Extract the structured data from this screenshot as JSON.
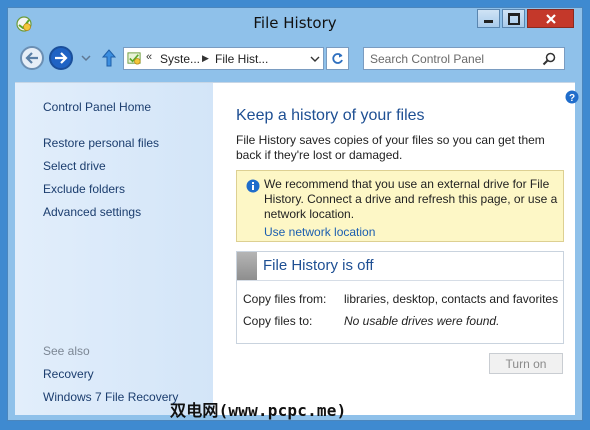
{
  "window": {
    "title": "File History",
    "min_label": "",
    "max_label": ""
  },
  "navbar": {
    "address_chevron": "«",
    "address_segments": [
      "Syste...",
      "File Hist..."
    ],
    "search_placeholder": "Search Control Panel",
    "search_value": ""
  },
  "sidebar": {
    "home": "Control Panel Home",
    "items": [
      "Restore personal files",
      "Select drive",
      "Exclude folders",
      "Advanced settings"
    ],
    "see_also_heading": "See also",
    "see_also": [
      "Recovery",
      "Windows 7 File Recovery"
    ]
  },
  "main": {
    "title": "Keep a history of your files",
    "description": "File History saves copies of your files so you can get them back if they're lost or damaged.",
    "notice": {
      "text": "We recommend that you use an external drive for File History. Connect a drive and refresh this page, or use a network location.",
      "link": "Use network location"
    },
    "status": {
      "title": "File History is off",
      "copy_from_label": "Copy files from:",
      "copy_from_value": "libraries, desktop, contacts and favorites",
      "copy_to_label": "Copy files to:",
      "copy_to_value": "No usable drives were found."
    },
    "turn_on_label": "Turn on"
  },
  "watermark": "双电网(www.pcpc.me)",
  "colors": {
    "desktop": "#3f8ad0",
    "frame": "#8fc1ea",
    "title_blue": "#1e4f93",
    "link_blue": "#1c5fb0",
    "notice_bg": "#fdf7c6",
    "close_red": "#c4382a"
  },
  "icons": {
    "app": "file-history-icon",
    "back": "back-arrow-icon",
    "forward": "forward-arrow-icon",
    "up": "up-arrow-icon",
    "refresh": "refresh-icon",
    "search": "search-icon",
    "help": "help-icon",
    "info": "info-icon"
  }
}
